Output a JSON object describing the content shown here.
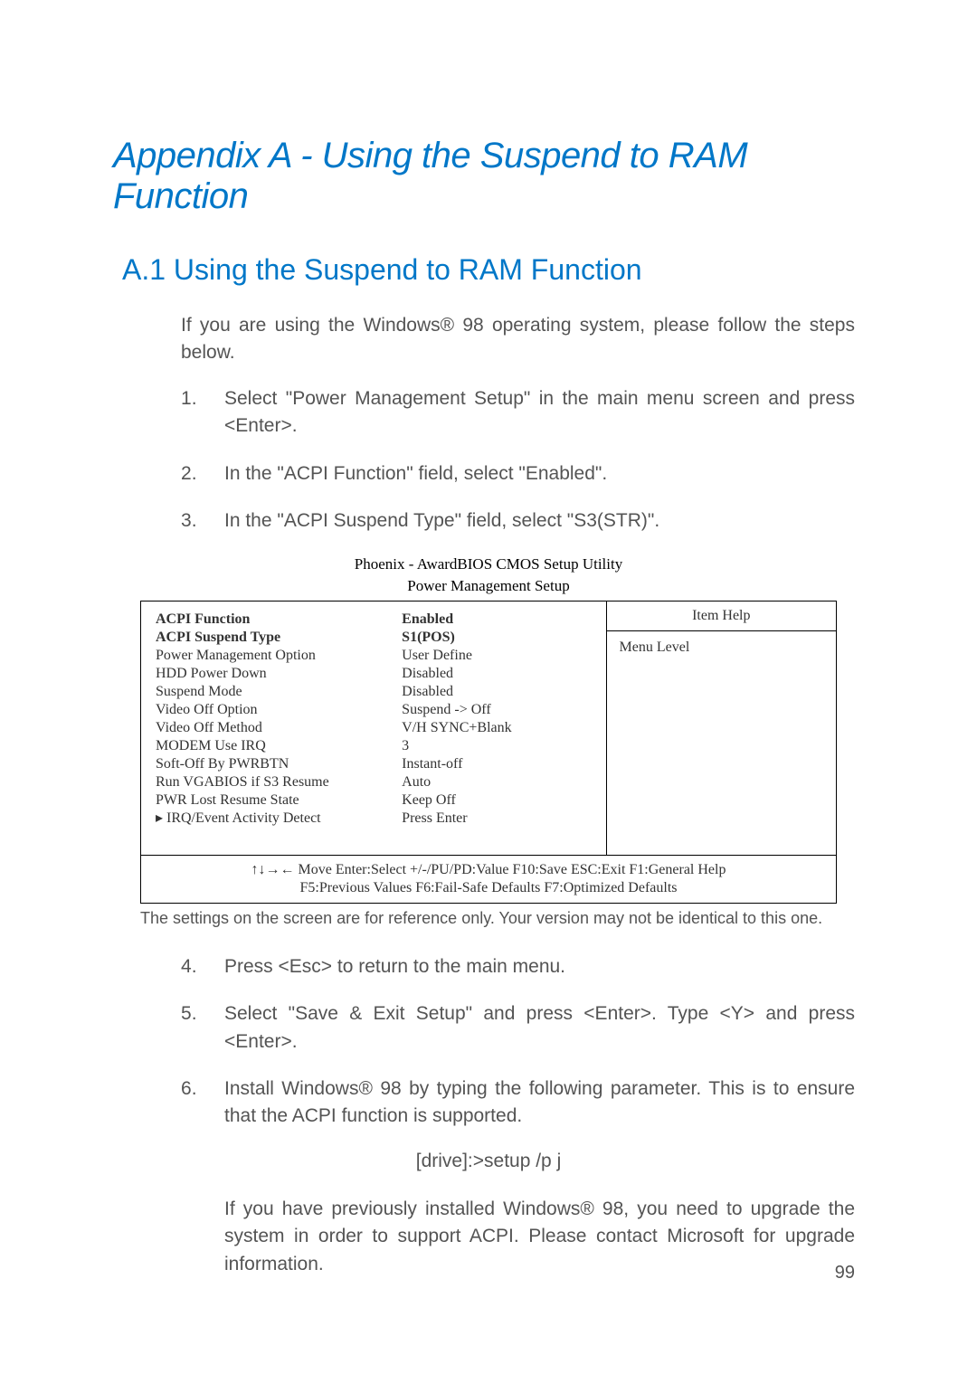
{
  "title_main": "Appendix A - Using the Suspend to RAM Function",
  "section_head": "A.1  Using the Suspend to RAM Function",
  "intro": "If you are using the Windows® 98 operating system, please follow the steps below.",
  "steps": {
    "s1": "Select \"Power Management Setup\" in the main menu screen and press <Enter>.",
    "s2": "In the \"ACPI Function\" field, select \"Enabled\".",
    "s3": "In the \"ACPI Suspend Type\" field, select \"S3(STR)\"."
  },
  "bios": {
    "caption1": "Phoenix - AwardBIOS CMOS Setup Utility",
    "caption2": "Power Management Setup",
    "rows": [
      {
        "label": "ACPI Function",
        "value": "Enabled",
        "bold": true
      },
      {
        "label": "ACPI Suspend Type",
        "value": "S1(POS)",
        "bold": true
      },
      {
        "label": "Power Management Option",
        "value": "User Define"
      },
      {
        "label": "HDD Power Down",
        "value": "Disabled"
      },
      {
        "label": "Suspend Mode",
        "value": "Disabled"
      },
      {
        "label": "Video Off Option",
        "value": "Suspend -> Off"
      },
      {
        "label": "Video Off Method",
        "value": "V/H SYNC+Blank"
      },
      {
        "label": "MODEM Use IRQ",
        "value": "3"
      },
      {
        "label": "Soft-Off By PWRBTN",
        "value": "Instant-off"
      },
      {
        "label": "Run VGABIOS if S3 Resume",
        "value": "Auto"
      },
      {
        "label": "PWR Lost Resume State",
        "value": "Keep Off"
      },
      {
        "label": "IRQ/Event Activity Detect",
        "value": "Press Enter",
        "sub": true
      }
    ],
    "help_head": "Item Help",
    "help_body": "Menu Level",
    "footer1": "↑↓→← Move   Enter:Select   +/-/PU/PD:Value   F10:Save      ESC:Exit   F1:General Help",
    "footer2": "F5:Previous Values       F6:Fail-Safe Defaults             F7:Optimized Defaults"
  },
  "footnote": "The settings on the screen are for reference only. Your version may not be identical to this one.",
  "steps2": {
    "s4": "Press <Esc> to return to the main menu.",
    "s5": "Select \"Save & Exit Setup\" and press <Enter>. Type <Y> and press <Enter>.",
    "s6": "Install Windows® 98 by typing the following parameter. This is to ensure that the ACPI function is supported."
  },
  "cmd": "[drive]:>setup /p j",
  "tail_para": "If you have previously installed Windows® 98, you need to upgrade the system in order to support ACPI. Please contact Microsoft for upgrade information.",
  "page_num": "99"
}
